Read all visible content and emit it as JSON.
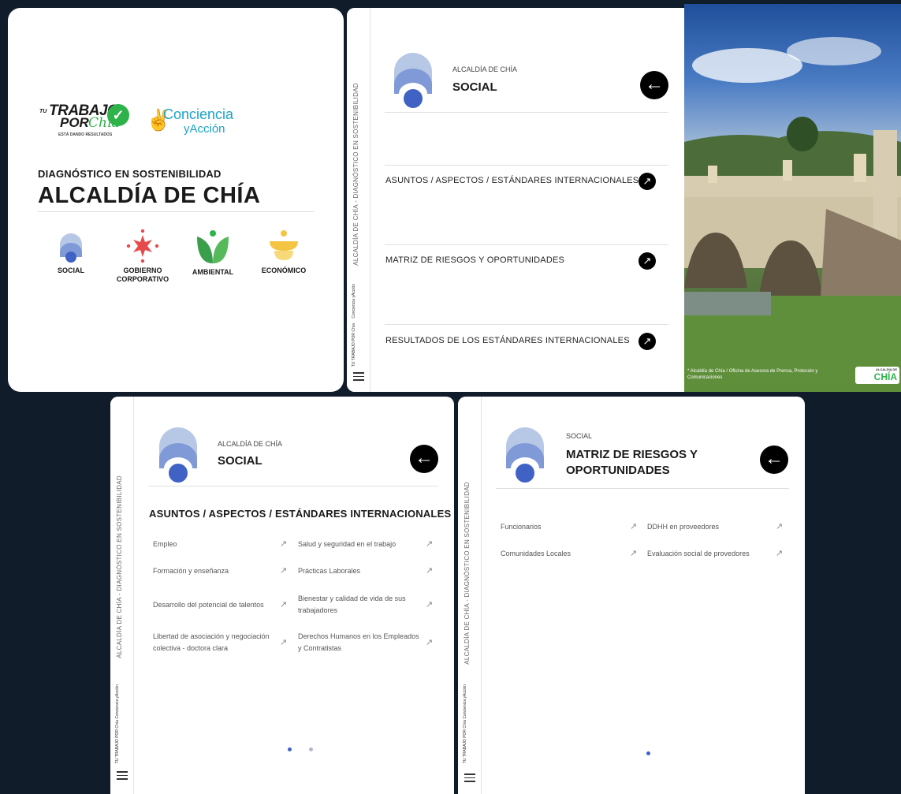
{
  "colors": {
    "social_blue_light": "#b7c7e6",
    "social_blue": "#7f9ad6",
    "social_blue_dark": "#3f62c4",
    "brand_green": "#2db34a",
    "accent_cyan": "#1aa3c7",
    "red": "#e74a4a",
    "yellow": "#f4c542"
  },
  "cover": {
    "logo_tu": "TU",
    "logo_trabajo": "TRABAJO",
    "logo_por": "POR",
    "logo_chia": "Chía",
    "logo_tag": "ESTÁ DANDO RESULTADOS",
    "logo_conciencia": "Conciencia",
    "logo_accion": "yAcción",
    "diagnostic": "DIAGNÓSTICO EN SOSTENIBILIDAD",
    "title": "ALCALDÍA DE CHÍA",
    "pillars": [
      {
        "label": "SOCIAL",
        "icon": "social-icon"
      },
      {
        "label": "GOBIERNO CORPORATIVO",
        "icon": "gobierno-icon"
      },
      {
        "label": "AMBIENTAL",
        "icon": "ambiental-icon"
      },
      {
        "label": "ECONÓMICO",
        "icon": "economico-icon"
      }
    ]
  },
  "sidebar": {
    "vertical_text": "ALCALDÍA DE CHÍA - DIAGNÓSTICO EN SOSTENIBILIDAD",
    "mini_logo_1": "Conciencia yAcción",
    "mini_logo_2": "TU TRABAJO POR Chía",
    "menu_icon": "hamburger-icon"
  },
  "social_menu": {
    "small": "ALCALDÍA DE CHÍA",
    "title": "SOCIAL",
    "back_icon": "arrow-left-icon",
    "items": [
      {
        "label": "ASUNTOS / ASPECTOS / ESTÁNDARES INTERNACIONALES"
      },
      {
        "label": "MATRIZ DE RIESGOS Y OPORTUNIDADES"
      },
      {
        "label": "RESULTADOS DE LOS ESTÁNDARES INTERNACIONALES"
      }
    ],
    "item_icon": "arrow-up-right-icon"
  },
  "photo": {
    "caption": "* Alcaldía de Chía / Oficina de Asesora de Prensa, Protocolo y Comunicaciones",
    "badge_small": "ALCALDÍA DE",
    "badge": "CHÍA"
  },
  "asuntos": {
    "small": "ALCALDÍA DE CHÍA",
    "title": "SOCIAL",
    "section": "ASUNTOS / ASPECTOS / ESTÁNDARES INTERNACIONALES",
    "left": [
      "Empleo",
      "Formación y enseñanza",
      "Desarrollo del potencial de talentos",
      "Libertad de asociación y negociación colectiva - doctora clara"
    ],
    "right": [
      "Salud y seguridad en el trabajo",
      "Prácticas Laborales",
      "Bienestar y calidad de vida de sus trabajadores",
      "Derechos Humanos en los Empleados y Contratistas"
    ],
    "arrow": "↗"
  },
  "matriz": {
    "small": "SOCIAL",
    "title_line1": "MATRIZ DE RIESGOS Y",
    "title_line2": "OPORTUNIDADES",
    "left": [
      "Funcionarios",
      "Comunidades Locales"
    ],
    "right": [
      "DDHH en proveedores",
      "Evaluación social de provedores"
    ],
    "arrow": "↗"
  }
}
